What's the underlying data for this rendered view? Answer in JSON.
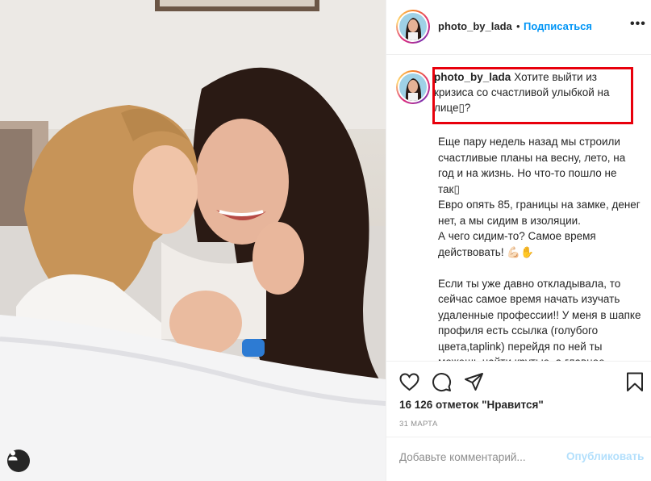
{
  "post": {
    "username": "photo_by_lada",
    "separator": "•",
    "follow_label": "Подписаться",
    "more_label": "•••"
  },
  "caption": {
    "username": "photo_by_lada",
    "headline": "Хотите выйти из кризиса со счастливой улыбкой на лице▯?",
    "paragraphs": [
      "Еще пару недель назад мы строили счастливые планы на весну, лето, на год и на жизнь. Но что-то пошло не так▯",
      "Евро опять 85, границы на замке, денег нет, а мы сидим в изоляции.",
      "А чего сидим-то? Самое время действовать! 💪🏻✋",
      "",
      "Если ты уже давно откладывала, то сейчас самое время начать изучать удаленные профессии!! У меня в шапке профиля есть ссылка (голубого цвета,taplink) перейдя по ней ты можешь найти крутые, а главное бесплатные прямые эфиры"
    ]
  },
  "engagement": {
    "likes_text": "16 126 отметок \"Нравится\"",
    "date": "31 МАРТА"
  },
  "comment_box": {
    "placeholder": "Добавьте комментарий...",
    "post_label": "Опубликовать"
  },
  "icons": {
    "like": "heart-icon",
    "comment": "comment-icon",
    "share": "paper-plane-icon",
    "save": "bookmark-icon",
    "tags": "user-tag-icon"
  },
  "colors": {
    "accent": "#0095f6",
    "post_disabled": "#b2dffc",
    "highlight_box": "#e8000c",
    "secondary_text": "#8e8e8e"
  }
}
